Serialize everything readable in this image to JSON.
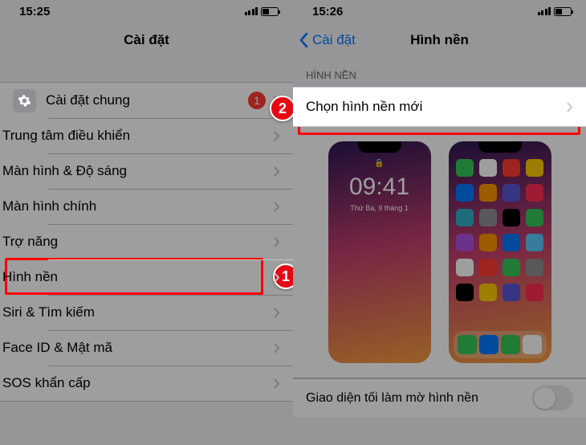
{
  "left": {
    "time": "15:25",
    "title": "Cài đặt",
    "items": {
      "general": "Cài đặt chung",
      "control_center": "Trung tâm điều khiển",
      "display": "Màn hình & Độ sáng",
      "home": "Màn hình chính",
      "accessibility": "Trợ năng",
      "wallpaper": "Hình nền",
      "siri": "Siri & Tìm kiếm",
      "faceid": "Face ID & Mật mã",
      "sos": "SOS khẩn cấp"
    },
    "badge_general": "1"
  },
  "right": {
    "time": "15:26",
    "back": "Cài đặt",
    "title": "Hình nền",
    "section": "HÌNH NỀN",
    "choose_new": "Chọn hình nền mới",
    "lock_time": "09:41",
    "lock_date": "Thứ Ba, 9 tháng 1",
    "dark_appearance": "Giao diện tối làm mờ hình nền"
  },
  "callouts": {
    "one": "1",
    "two": "2"
  }
}
